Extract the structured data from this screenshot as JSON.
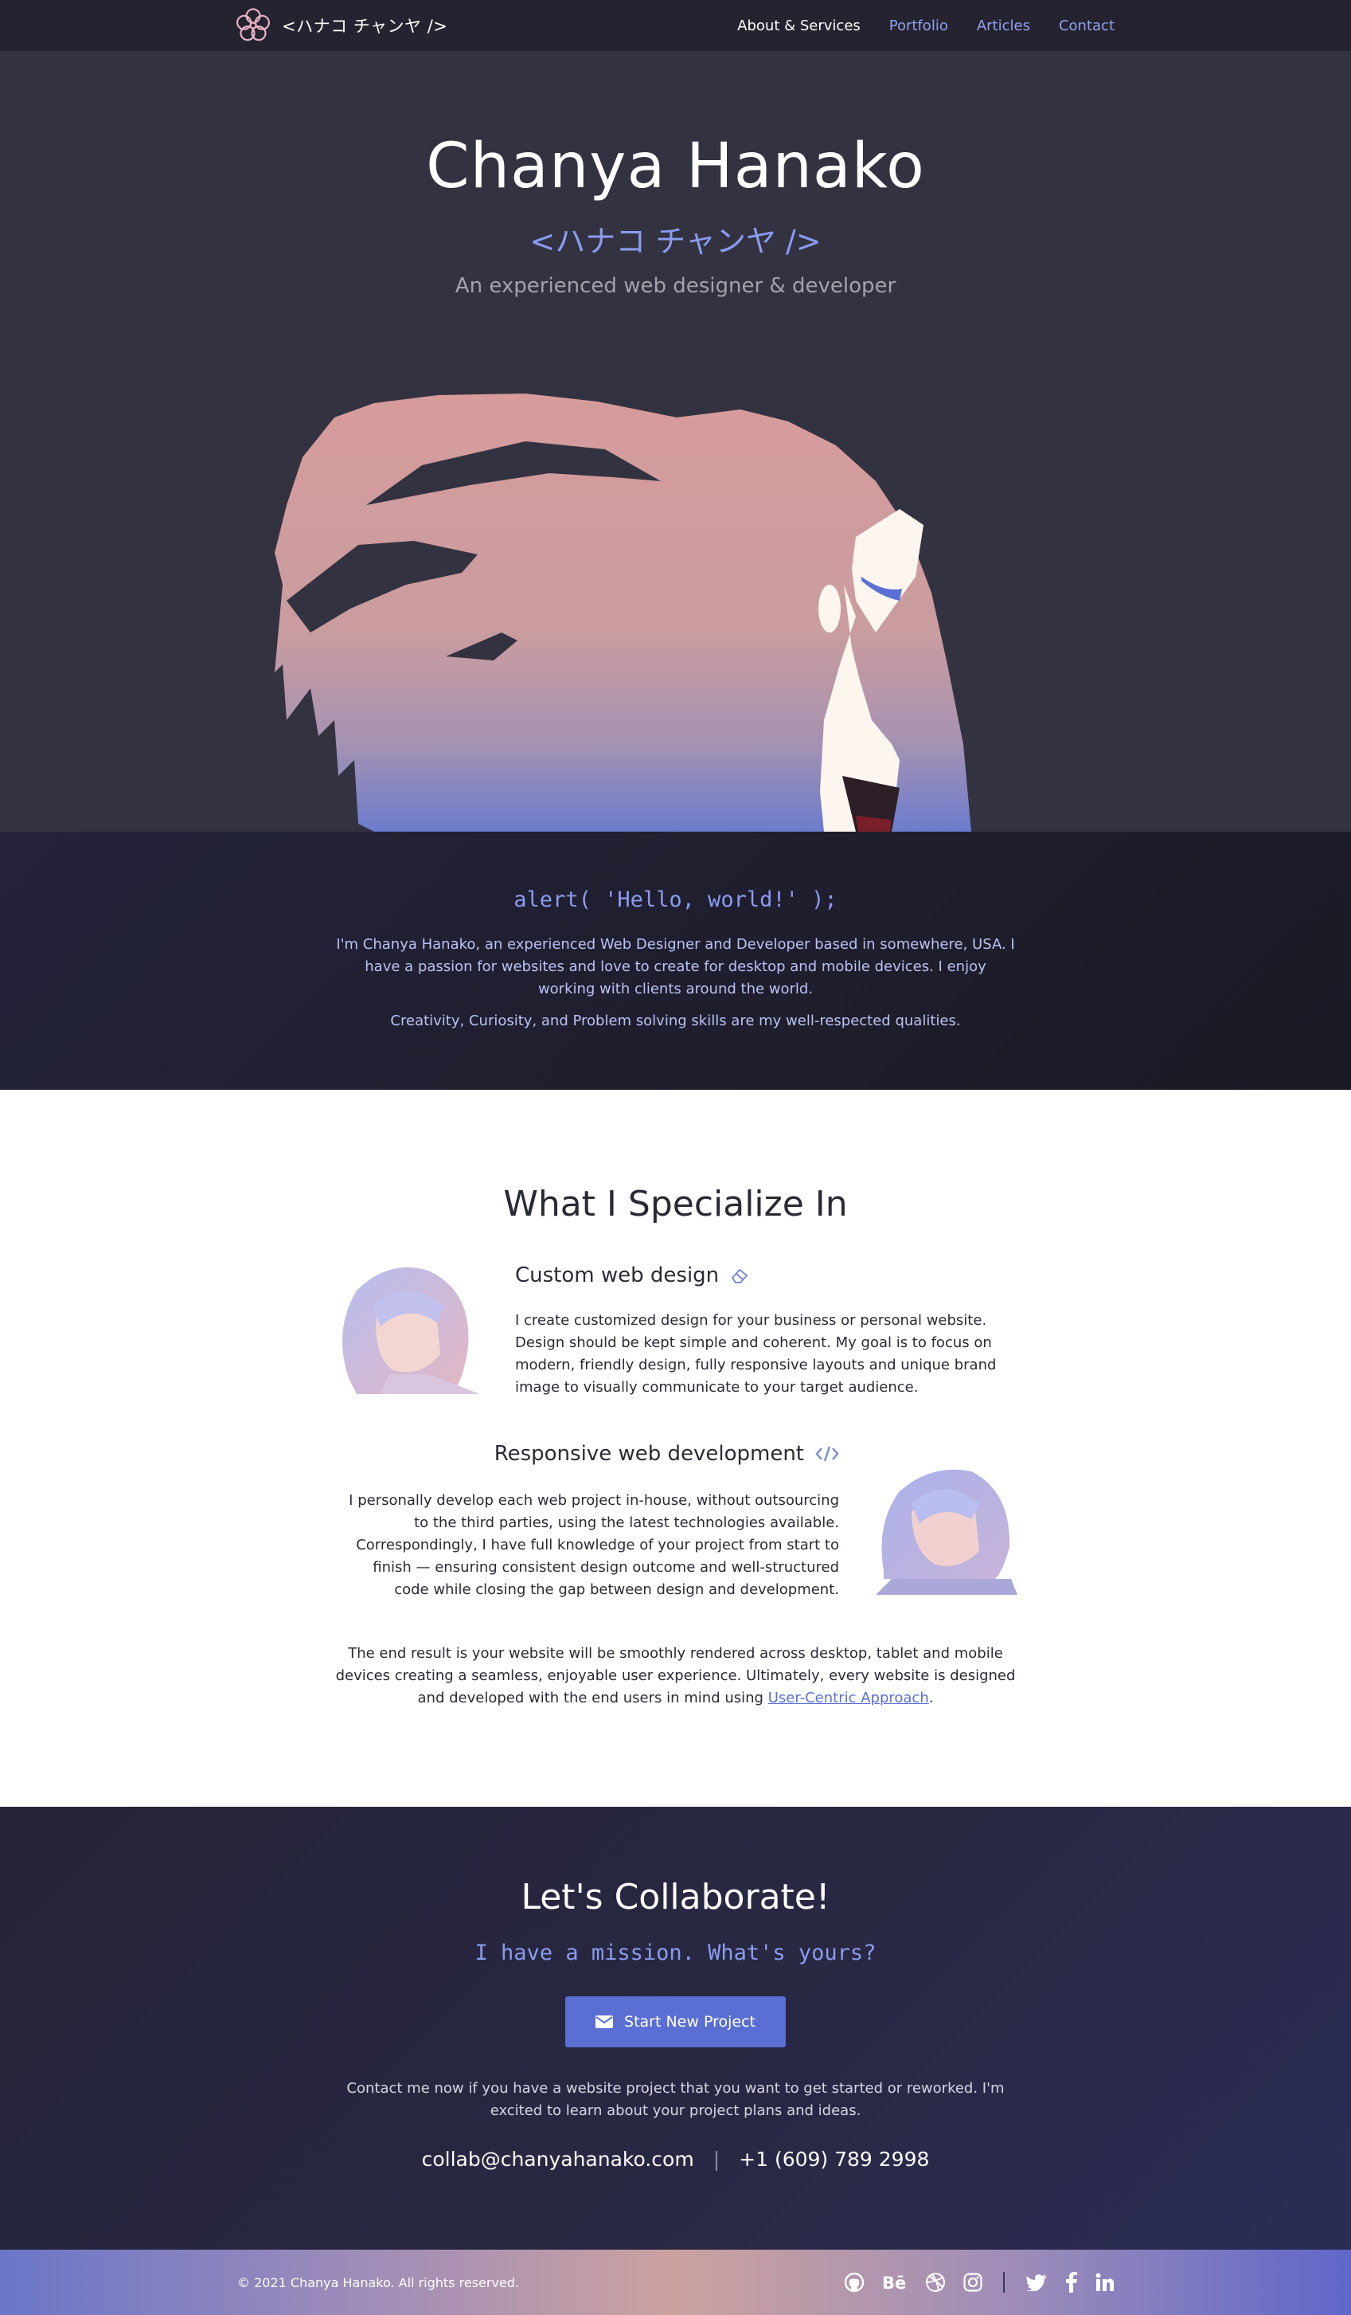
{
  "nav": {
    "logo_text": "<ハナコ チャンヤ />",
    "links": [
      "About & Services",
      "Portfolio",
      "Articles",
      "Contact"
    ]
  },
  "hero": {
    "name": "Chanya Hanako",
    "jp_name": "<ハナコ チャンヤ />",
    "tagline": "An experienced web designer & developer"
  },
  "intro": {
    "code": "alert( 'Hello, world!' );",
    "p1": "I'm Chanya Hanako, an experienced Web Designer and Developer based in somewhere, USA. I have a passion for websites and love to create for desktop and mobile devices. I enjoy working with clients around the world.",
    "p2": "Creativity, Curiosity, and Problem solving skills are my well-respected qualities."
  },
  "specialize": {
    "title": "What I Specialize In",
    "card1": {
      "title": "Custom web design",
      "icon": "eraser-icon",
      "text": "I create customized design for your business or personal website. Design should be kept simple and coherent. My goal is to focus on modern, friendly design, fully responsive layouts and unique brand image to visually communicate to your target audience."
    },
    "card2": {
      "title": "Responsive web development",
      "icon": "code-icon",
      "text": "I personally develop each web project in-house, without outsourcing to the third parties, using the latest technologies available. Correspondingly, I have full knowledge of your project from start to finish — ensuring consistent design outcome and well-structured code while closing the gap between design and development."
    },
    "result_text": "The end result is your website will be smoothly rendered across desktop, tablet and mobile devices creating a seamless, enjoyable user experience. Ultimately, every website is designed and developed with the end users in mind using",
    "result_link": "User-Centric Approach",
    "result_end": "."
  },
  "collab": {
    "title": "Let's Collaborate!",
    "mission": "I have a mission. What's yours?",
    "button": "Start New Project",
    "text": "Contact me now if you have a website project that you want to get started or reworked. I'm excited to learn about your project plans and ideas.",
    "email": "collab@chanyahanako.com",
    "separator": "|",
    "phone": "+1 (609) 789 2998"
  },
  "footer": {
    "copyright": "© 2021 Chanya Hanako. All rights reserved.",
    "socials": [
      "github-icon",
      "behance-icon",
      "dribbble-icon",
      "instagram-icon",
      "twitter-icon",
      "facebook-icon",
      "linkedin-icon"
    ]
  },
  "colors": {
    "nav_bg": "#24232f",
    "hero_bg": "#333240",
    "accent": "#8a9cf0",
    "button": "#5b6ed4",
    "hair_pink": "#d59f9e"
  }
}
